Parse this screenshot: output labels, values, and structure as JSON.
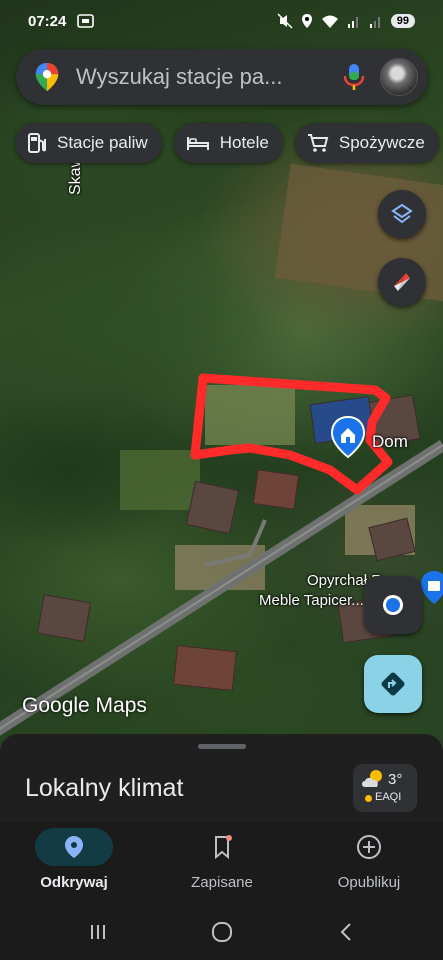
{
  "status_bar": {
    "time": "07:24",
    "battery": "99"
  },
  "search": {
    "placeholder": "Wyszukaj stacje pa..."
  },
  "chips": [
    {
      "label": "Stacje paliw",
      "icon": "gas-station-icon"
    },
    {
      "label": "Hotele",
      "icon": "bed-icon"
    },
    {
      "label": "Spożywcze",
      "icon": "cart-icon"
    }
  ],
  "map": {
    "labels": {
      "street": "Skaw",
      "place": "Dom",
      "business_line1": "Opyrchał R...",
      "business_line2": "Meble Tapicer..."
    },
    "watermark": "Google Maps"
  },
  "sheet": {
    "title": "Lokalny klimat",
    "weather": {
      "temperature": "3°",
      "aqi": "EAQI"
    }
  },
  "bottom_nav": [
    {
      "label": "Odkrywaj",
      "active": true
    },
    {
      "label": "Zapisane",
      "active": false
    },
    {
      "label": "Opublikuj",
      "active": false
    }
  ],
  "colors": {
    "accent": "#8ab4f8",
    "drawing": "#ff2a2a",
    "sheet": "#1f1f1f"
  }
}
